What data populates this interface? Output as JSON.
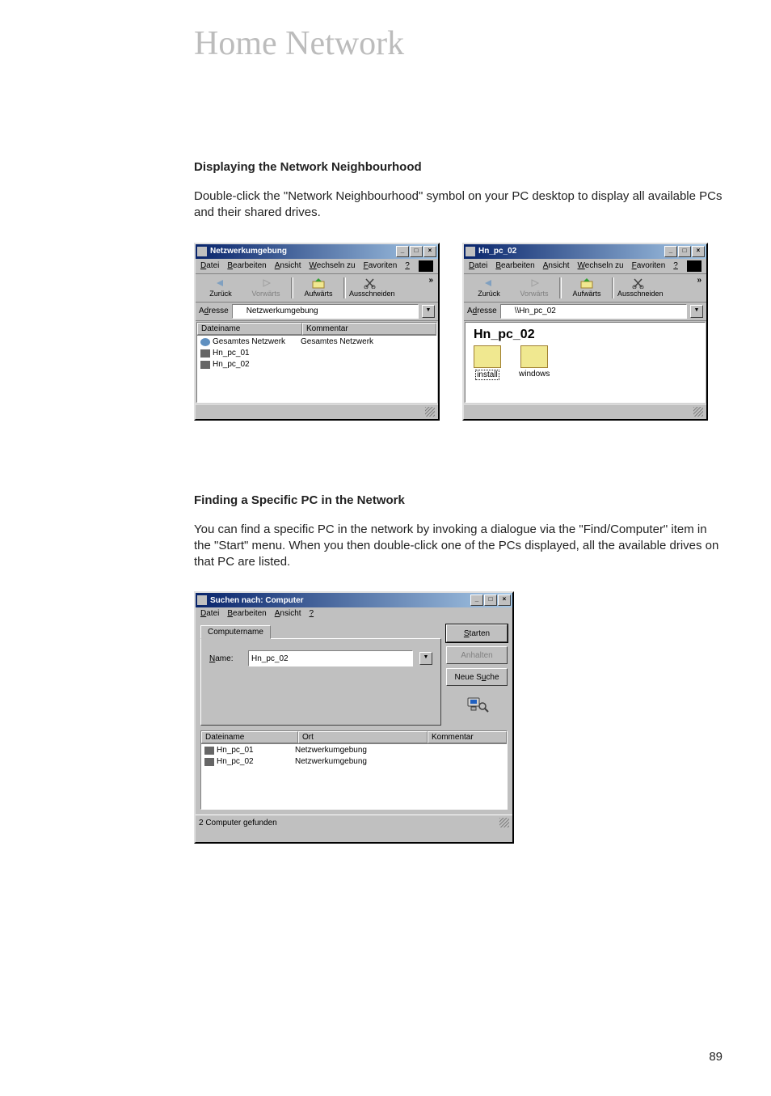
{
  "chapter_title": "Home Network",
  "section1": {
    "heading": "Displaying the Network Neighbourhood",
    "body": "Double-click the \"Network Neighbourhood\" symbol on your PC desktop to display all available PCs and their shared drives."
  },
  "section2": {
    "heading": "Finding a Specific PC in the Network",
    "body": "You can find a specific PC in the network by invoking a dialogue via the \"Find/Computer\" item in the \"Start\" menu. When you then double-click one of the PCs displayed, all the available drives on that PC are listed."
  },
  "page_number": "89",
  "win_a": {
    "title": "Netzwerkumgebung",
    "menu": [
      "Datei",
      "Bearbeiten",
      "Ansicht",
      "Wechseln zu",
      "Favoriten",
      "?"
    ],
    "toolbar": {
      "back": "Zurück",
      "forward": "Vorwärts",
      "up": "Aufwärts",
      "cut": "Ausschneiden",
      "more": "»"
    },
    "address_label": "Adresse",
    "address_text": "Netzwerkumgebung",
    "columns": [
      "Dateiname",
      "Kommentar"
    ],
    "rows": [
      {
        "name": "Gesamtes Netzwerk",
        "comment": "Gesamtes Netzwerk"
      },
      {
        "name": "Hn_pc_01",
        "comment": ""
      },
      {
        "name": "Hn_pc_02",
        "comment": ""
      }
    ]
  },
  "win_b": {
    "title": "Hn_pc_02",
    "menu": [
      "Datei",
      "Bearbeiten",
      "Ansicht",
      "Wechseln zu",
      "Favoriten",
      "?"
    ],
    "toolbar": {
      "back": "Zurück",
      "forward": "Vorwärts",
      "up": "Aufwärts",
      "cut": "Ausschneiden",
      "more": "»"
    },
    "address_label": "Adresse",
    "address_text": "\\\\Hn_pc_02",
    "big_title": "Hn_pc_02",
    "icons": [
      {
        "label": "install"
      },
      {
        "label": "windows"
      }
    ]
  },
  "win_c": {
    "title": "Suchen nach: Computer",
    "menu": [
      "Datei",
      "Bearbeiten",
      "Ansicht",
      "?"
    ],
    "tab_label": "Computername",
    "name_label": "Name:",
    "name_value": "Hn_pc_02",
    "buttons": {
      "start": "Starten",
      "stop": "Anhalten",
      "new": "Neue Suche"
    },
    "result_columns": [
      "Dateiname",
      "Ort",
      "Kommentar"
    ],
    "results": [
      {
        "name": "Hn_pc_01",
        "loc": "Netzwerkumgebung",
        "comment": ""
      },
      {
        "name": "Hn_pc_02",
        "loc": "Netzwerkumgebung",
        "comment": ""
      }
    ],
    "status": "2 Computer gefunden"
  }
}
